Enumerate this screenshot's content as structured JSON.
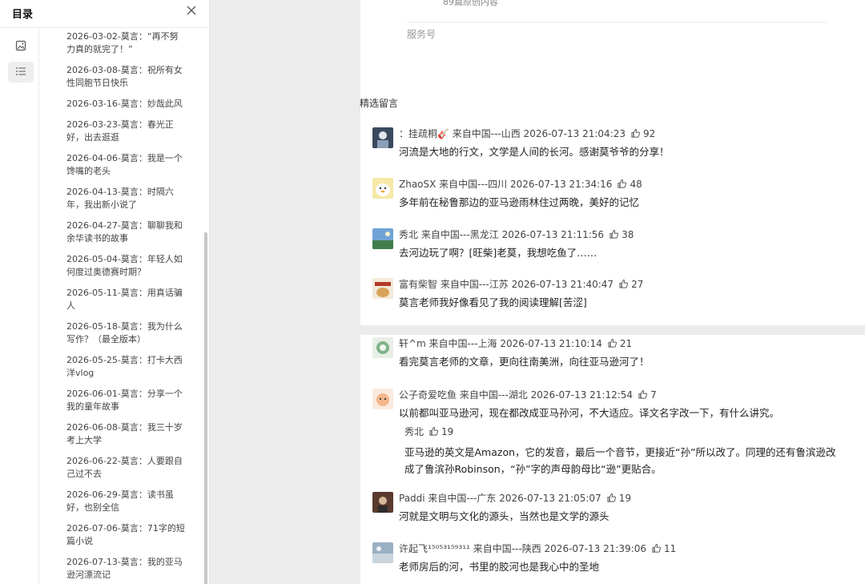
{
  "toc": {
    "title": "目录",
    "items": [
      "2026-03-02-莫言：“再不努力真的就完了！”",
      "2026-03-08-莫言：祝所有女性同胞节日快乐",
      "2026-03-16-莫言：妙哉此风",
      "2026-03-23-莫言：春光正好，出去逛逛",
      "2026-04-06-莫言：我是一个馋嘴的老头",
      "2026-04-13-莫言：时隔六年，我出新小说了",
      "2026-04-27-莫言：聊聊我和余华读书的故事",
      "2026-05-04-莫言：年轻人如何度过奥德赛时期？",
      "2026-05-11-莫言：用真话骗人",
      "2026-05-18-莫言：我为什么写作？（最全版本）",
      "2026-05-25-莫言：打卡大西洋vlog",
      "2026-06-01-莫言：分享一个我的童年故事",
      "2026-06-08-莫言：我三十岁考上大学",
      "2026-06-22-莫言：人要跟自己过不去",
      "2026-06-29-莫言：读书虽好，也别全信",
      "2026-07-06-莫言：71字的短篇小说",
      "2026-07-13-莫言：我的亚马逊河漂流记"
    ]
  },
  "account": {
    "original_count": "89篇原创内容",
    "type": "服务号"
  },
  "comments_section": {
    "title": "精选留言",
    "comments": [
      {
        "user": "：挂疏桐🎸 来自中国---山西 2026-07-13 21:04:23",
        "likes": "92",
        "text": "河流是大地的行文，文学是人间的长河。感谢莫爷爷的分享！"
      },
      {
        "user": "ZhaoSX 来自中国---四川 2026-07-13 21:34:16",
        "likes": "48",
        "text": "多年前在秘鲁那边的亚马逊雨林住过两晚，美好的记忆"
      },
      {
        "user": "秀北 来自中国---黑龙江 2026-07-13 21:11:56",
        "likes": "38",
        "text": "去河边玩了啊？[旺柴]老莫，我想吃鱼了……"
      },
      {
        "user": "富有柴智 来自中国---江苏 2026-07-13 21:40:47",
        "likes": "27",
        "text": "莫言老师我好像看见了我的阅读理解[苦涩]"
      },
      {
        "user": "轩^m 来自中国---上海 2026-07-13 21:10:14",
        "likes": "21",
        "text": "看完莫言老师的文章，更向往南美洲，向往亚马逊河了！"
      },
      {
        "user": "公子奇爱吃鱼 来自中国---湖北 2026-07-13 21:12:54",
        "likes": "7",
        "text": "以前都叫亚马逊河，现在都改成亚马孙河，不大适应。译文名字改一下，有什么讲究。"
      },
      {
        "user": "Paddi 来自中国---广东 2026-07-13 21:05:07",
        "likes": "19",
        "text": "河就是文明与文化的源头，当然也是文学的源头"
      },
      {
        "user": "许起飞¹⁵⁰⁵³¹⁵⁹³¹¹ 来自中国---陕西 2026-07-13 21:39:06",
        "likes": "11",
        "text": "老师房后的河，书里的胶河也是我心中的圣地"
      }
    ],
    "reply": {
      "user": "秀北",
      "likes": "19",
      "text": "亚马逊的英文是Amazon，它的发音，最后一个音节，更接近“孙”所以改了。同理的还有鲁滨逊改成了鲁滨孙Robinson，“孙”字的声母韵母比“逊”更贴合。"
    }
  }
}
